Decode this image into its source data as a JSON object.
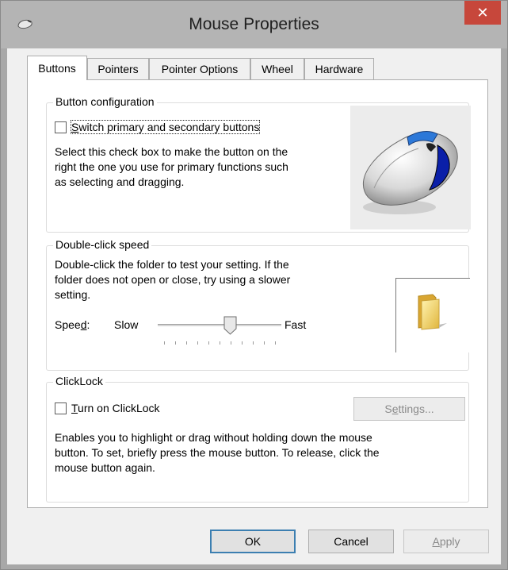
{
  "window": {
    "title": "Mouse Properties",
    "close_glyph": "✕",
    "accent": "#c7473b"
  },
  "tabs": [
    {
      "label": "Buttons",
      "active": true
    },
    {
      "label": "Pointers",
      "active": false
    },
    {
      "label": "Pointer Options",
      "active": false
    },
    {
      "label": "Wheel",
      "active": false
    },
    {
      "label": "Hardware",
      "active": false
    }
  ],
  "button_config": {
    "title": "Button configuration",
    "checkbox_label_mnemonic": "S",
    "checkbox_label_rest": "witch primary and secondary buttons",
    "checked": false,
    "description_lines": [
      "Select this check box to make the button on the",
      "right the one you use for primary functions such",
      "as selecting and dragging."
    ],
    "image_icon": "mouse-icon"
  },
  "double_click": {
    "title": "Double-click speed",
    "description_lines": [
      "Double-click the folder to test your setting. If the",
      "folder does not open or close, try using a slower",
      "setting."
    ],
    "speed_label_prefix": "Spee",
    "speed_label_mnemonic": "d",
    "speed_label_suffix": ":",
    "slow_label": "Slow",
    "fast_label": "Fast",
    "slider_fraction": 0.6,
    "tick_count": 11,
    "folder_icon": "folder-icon"
  },
  "clicklock": {
    "title": "ClickLock",
    "checkbox_label_mnemonic": "T",
    "checkbox_label_rest": "urn on ClickLock",
    "checked": false,
    "settings_prefix": "S",
    "settings_mnemonic": "e",
    "settings_suffix": "ttings...",
    "settings_enabled": false,
    "description_lines": [
      "Enables you to highlight or drag without holding down the mouse",
      "button. To set, briefly press the mouse button. To release, click the",
      "mouse button again."
    ]
  },
  "footer": {
    "ok": "OK",
    "cancel": "Cancel",
    "apply_mnemonic": "A",
    "apply_rest": "pply"
  }
}
